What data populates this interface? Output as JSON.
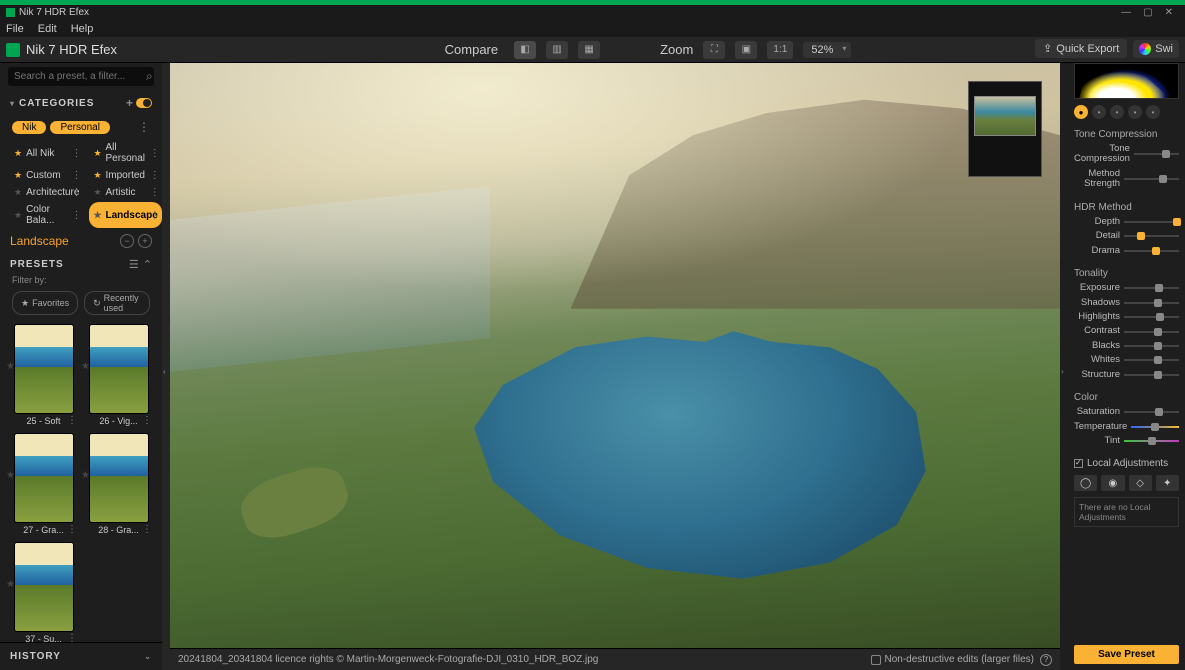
{
  "window": {
    "title": "Nik 7 HDR Efex"
  },
  "menubar": [
    "File",
    "Edit",
    "Help"
  ],
  "crumb": {
    "title": "Nik 7 HDR Efex"
  },
  "toolbar": {
    "compare": "Compare",
    "zoom_label": "Zoom",
    "ratio": "1:1",
    "zoom_value": "52%",
    "quick_export": "Quick Export",
    "swi": "Swi"
  },
  "search": {
    "placeholder": "Search a preset, a filter..."
  },
  "categories": {
    "header": "CATEGORIES",
    "pills": {
      "nik": "Nik",
      "personal": "Personal"
    },
    "items": [
      {
        "star": true,
        "label": "All Nik"
      },
      {
        "star": true,
        "label": "All Personal"
      },
      {
        "star": true,
        "label": "Custom"
      },
      {
        "star": true,
        "label": "Imported"
      },
      {
        "star": false,
        "label": "Architecture"
      },
      {
        "star": false,
        "label": "Artistic"
      },
      {
        "star": false,
        "label": "Color Bala..."
      },
      {
        "star": false,
        "label": "Landscape",
        "selected": true
      }
    ]
  },
  "landscape_label": "Landscape",
  "presets": {
    "header": "PRESETS",
    "filter_by": "Filter by:",
    "chips": {
      "favorites": "Favorites",
      "recently": "Recently used"
    },
    "thumbs": [
      {
        "label": "25 - Soft"
      },
      {
        "label": "26 - Vig..."
      },
      {
        "label": "27 - Gra..."
      },
      {
        "label": "28 - Gra..."
      },
      {
        "label": "37 - Su..."
      }
    ]
  },
  "history": "HISTORY",
  "statusbar": {
    "filename": "20241804_20341804 licence rights © Martin-Morgenweck-Fotografie-DJI_0310_HDR_BOZ.jpg",
    "nondestructive": "Non-destructive edits (larger files)"
  },
  "right": {
    "tone_compression": {
      "header": "Tone Compression",
      "sliders": [
        {
          "label": "Tone Compression",
          "pos": 72
        },
        {
          "label": "Method Strength",
          "pos": 70
        }
      ]
    },
    "hdr": {
      "header": "HDR Method",
      "sliders": [
        {
          "label": "Depth",
          "pos": 96,
          "orange": true
        },
        {
          "label": "Detail",
          "pos": 30,
          "orange": true
        },
        {
          "label": "Drama",
          "pos": 58,
          "orange": true
        }
      ]
    },
    "tonality": {
      "header": "Tonality",
      "sliders": [
        {
          "label": "Exposure",
          "pos": 64
        },
        {
          "label": "Shadows",
          "pos": 62
        },
        {
          "label": "Highlights",
          "pos": 66
        },
        {
          "label": "Contrast",
          "pos": 62
        },
        {
          "label": "Blacks",
          "pos": 62
        },
        {
          "label": "Whites",
          "pos": 62
        },
        {
          "label": "Structure",
          "pos": 62
        }
      ]
    },
    "color": {
      "header": "Color",
      "sliders": [
        {
          "label": "Saturation",
          "pos": 64
        },
        {
          "label": "Temperature",
          "pos": 50,
          "temp": true
        },
        {
          "label": "Tint",
          "pos": 50,
          "tint": true
        }
      ]
    },
    "local": {
      "header": "Local Adjustments",
      "none": "There are no Local Adjustments"
    },
    "save": "Save Preset"
  }
}
